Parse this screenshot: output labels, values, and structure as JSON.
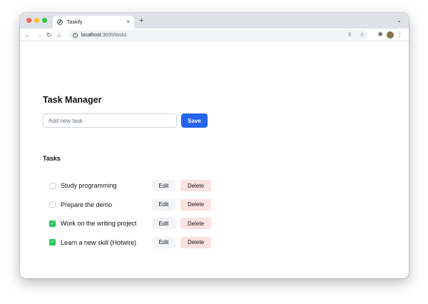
{
  "browser": {
    "tab_title": "Taskify",
    "tab_close": "×",
    "new_tab": "+",
    "tab_menu": "⌄",
    "url_host": "localhost",
    "url_path": ":3000/tasks",
    "nav": {
      "back": "←",
      "forward": "→",
      "reload": "↻",
      "home": "⌂"
    },
    "actions": {
      "share": "⇪",
      "bookmark": "☆",
      "extensions": "✱",
      "menu": "⋮"
    }
  },
  "page": {
    "title": "Task Manager",
    "new_task_placeholder": "Add new task",
    "new_task_value": "",
    "save_label": "Save",
    "section_title": "Tasks"
  },
  "tasks": [
    {
      "label": "Study programming",
      "done": false,
      "edit_label": "Edit",
      "delete_label": "Delete"
    },
    {
      "label": "Prepare the demo",
      "done": false,
      "edit_label": "Edit",
      "delete_label": "Delete"
    },
    {
      "label": "Work on the writing project",
      "done": true,
      "edit_label": "Edit",
      "delete_label": "Delete"
    },
    {
      "label": "Learn a new skill (Hotwire)",
      "done": true,
      "edit_label": "Edit",
      "delete_label": "Delete"
    }
  ],
  "colors": {
    "primary": "#2563eb",
    "checked": "#22c55e",
    "delete_bg": "#fde2e2",
    "edit_bg": "#f3f4f6"
  }
}
